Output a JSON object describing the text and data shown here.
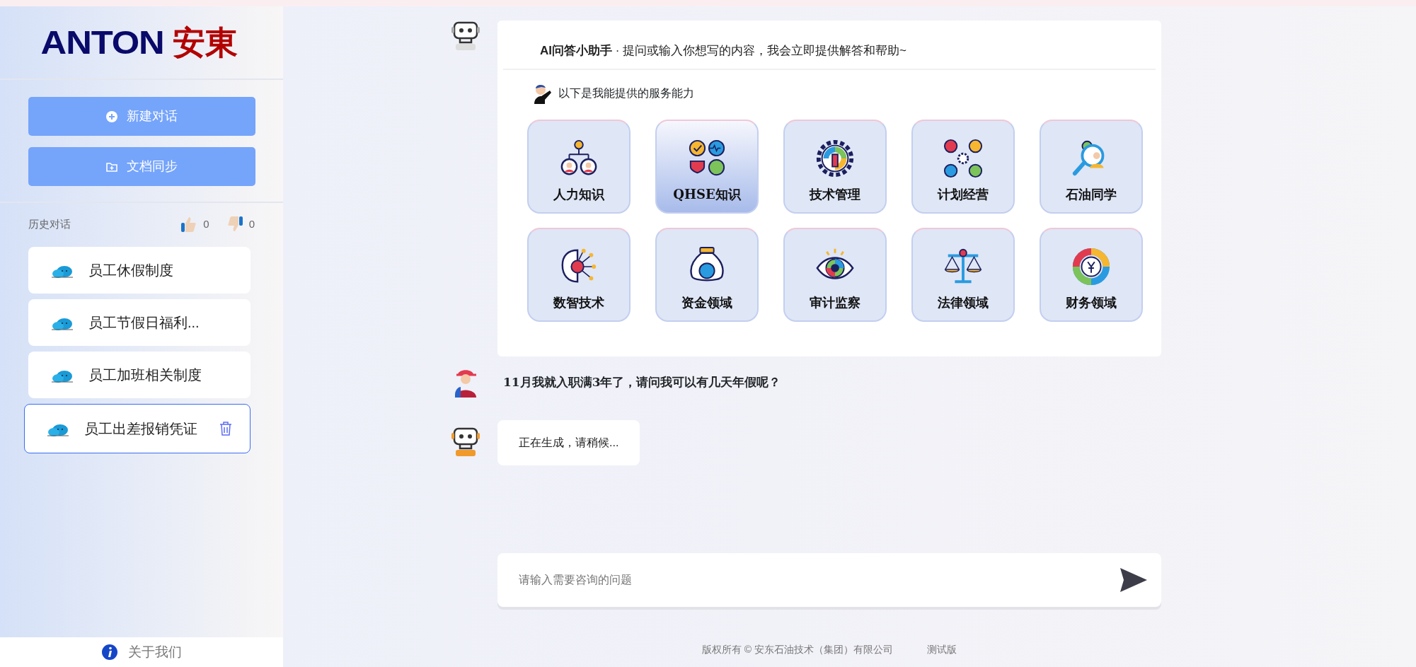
{
  "logo": {
    "latin": "ANTON",
    "cjk": "安東"
  },
  "sidebar_buttons": [
    {
      "label": "新建对话",
      "kind": "new"
    },
    {
      "label": "文档同步",
      "kind": "sync"
    }
  ],
  "history": {
    "label": "历史对话",
    "likes": "0",
    "dislikes": "0"
  },
  "conversations": [
    {
      "title": "员工休假制度",
      "selected": false
    },
    {
      "title": "员工节假日福利...",
      "selected": false
    },
    {
      "title": "员工加班相关制度",
      "selected": false
    },
    {
      "title": "员工出差报销凭证",
      "selected": true
    }
  ],
  "about": "关于我们",
  "assistant": {
    "title": "AI问答小助手",
    "subtitle": "· 提问或输入你想写的内容，我会立即提供解答和帮助~",
    "intro": "以下是我能提供的服务能力"
  },
  "services": [
    {
      "label": "人力知识",
      "kind": "people",
      "selected": false
    },
    {
      "label": "QHSE知识",
      "kind": "quality",
      "selected": true
    },
    {
      "label": "技术管理",
      "kind": "gear",
      "selected": false
    },
    {
      "label": "计划经营",
      "kind": "planning",
      "selected": false
    },
    {
      "label": "石油同学",
      "kind": "search",
      "selected": false
    },
    {
      "label": "数智技术",
      "kind": "brain",
      "selected": false
    },
    {
      "label": "资金领域",
      "kind": "moneybag",
      "selected": false
    },
    {
      "label": "审计监察",
      "kind": "eye",
      "selected": false
    },
    {
      "label": "法律领域",
      "kind": "scales",
      "selected": false
    },
    {
      "label": "财务领域",
      "kind": "donut",
      "selected": false
    }
  ],
  "messages": [
    {
      "kind": "user",
      "text": "11月我就入职满3年了，请问我可以有几天年假呢？"
    },
    {
      "kind": "bot",
      "text": "正在生成，请稍候..."
    }
  ],
  "input": {
    "placeholder": "请输入需要咨询的问题"
  },
  "footer": {
    "copyright": "版权所有 © 安东石油技术（集团）有限公司",
    "version": "测试版"
  }
}
